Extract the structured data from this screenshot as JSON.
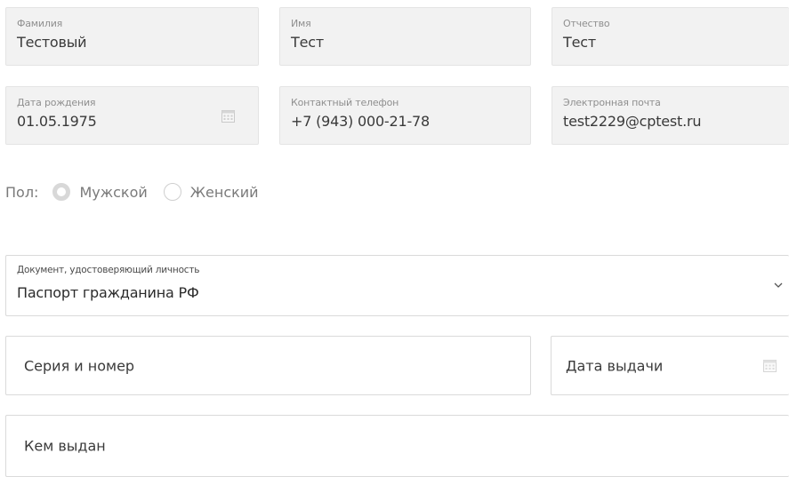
{
  "personal": {
    "last_name": {
      "label": "Фамилия",
      "value": "Тестовый"
    },
    "first_name": {
      "label": "Имя",
      "value": "Тест"
    },
    "patronymic": {
      "label": "Отчество",
      "value": "Тест"
    },
    "birth_date": {
      "label": "Дата рождения",
      "value": "01.05.1975"
    },
    "phone": {
      "label": "Контактный телефон",
      "value": "+7 (943) 000-21-78"
    },
    "email": {
      "label": "Электронная почта",
      "value": "test2229@cptest.ru"
    }
  },
  "gender": {
    "label": "Пол:",
    "options": [
      {
        "label": "Мужской",
        "selected": true
      },
      {
        "label": "Женский",
        "selected": false
      }
    ]
  },
  "document": {
    "type_label": "Документ, удостоверяющий личность",
    "type_value": "Паспорт гражданина РФ",
    "series_number_placeholder": "Серия и номер",
    "issue_date_placeholder": "Дата выдачи",
    "issued_by_placeholder": "Кем выдан"
  },
  "icons": {
    "calendar": "calendar-icon",
    "dropdown": "chevron-down-icon"
  }
}
